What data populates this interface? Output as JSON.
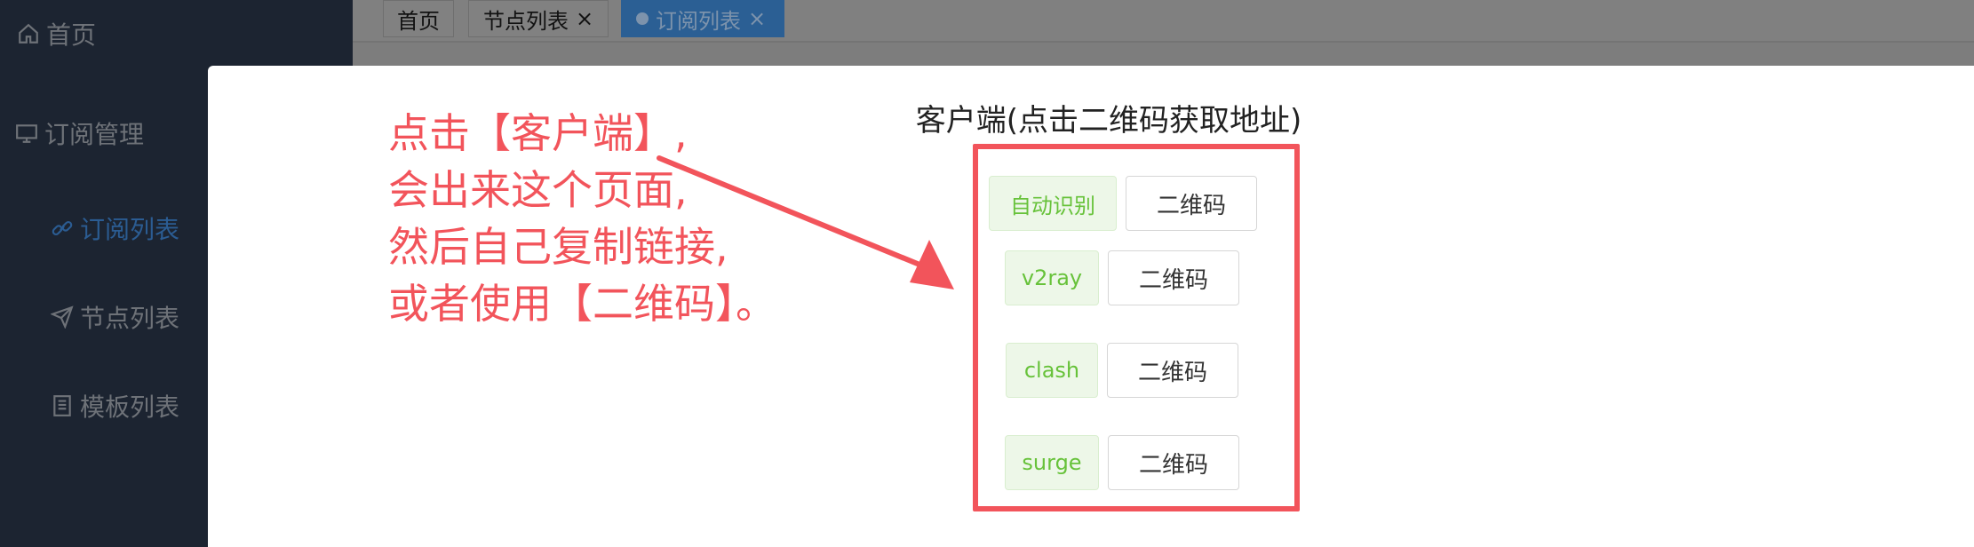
{
  "sidebar": {
    "items": [
      {
        "label": "首页",
        "icon": "home-icon"
      },
      {
        "label": "订阅管理",
        "icon": "monitor-icon"
      },
      {
        "label": "订阅列表",
        "icon": "link-icon"
      },
      {
        "label": "节点列表",
        "icon": "send-icon"
      },
      {
        "label": "模板列表",
        "icon": "document-icon"
      }
    ]
  },
  "tabs": [
    {
      "label": "首页"
    },
    {
      "label": "节点列表",
      "close": "×"
    },
    {
      "label": "订阅列表",
      "close": "×"
    }
  ],
  "modal": {
    "title": "客户端(点击二维码获取地址)",
    "clients": [
      {
        "name": "自动识别",
        "qr_label": "二维码"
      },
      {
        "name": "v2ray",
        "qr_label": "二维码"
      },
      {
        "name": "clash",
        "qr_label": "二维码"
      },
      {
        "name": "surge",
        "qr_label": "二维码"
      }
    ]
  },
  "annotation": {
    "lines": [
      "点击【客户端】,",
      "会出来这个页面,",
      "然后自己复制链接,",
      "或者使用【二维码】。"
    ]
  },
  "colors": {
    "sidebar_bg": "#1c2431",
    "active_blue": "#2b5f94",
    "annotation_red": "#f2545b",
    "success_green": "#67c23a"
  }
}
